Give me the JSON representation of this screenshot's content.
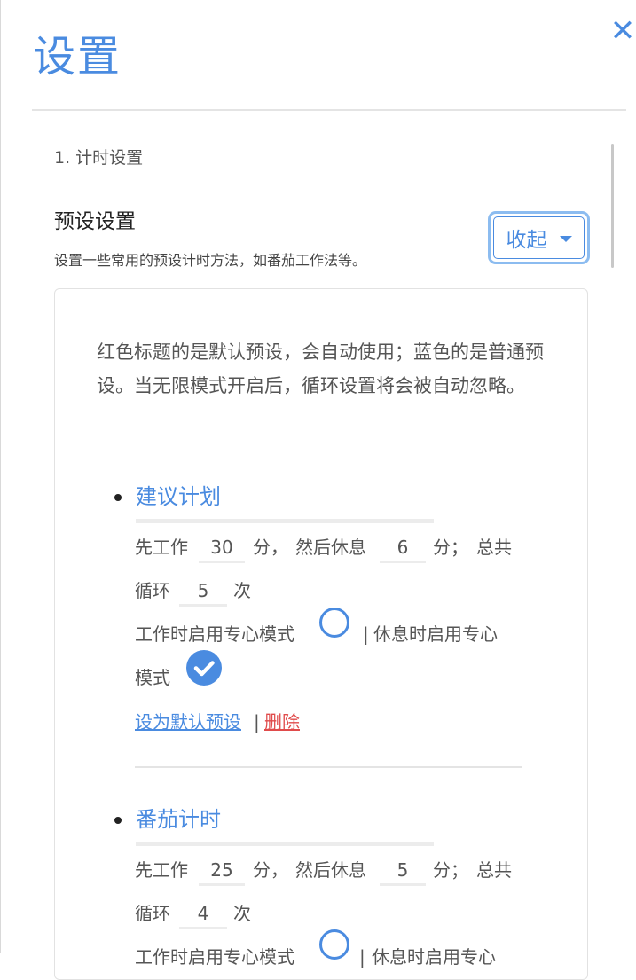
{
  "header": {
    "title": "设置",
    "close_label": "✕"
  },
  "section": {
    "label": "1. 计时设置"
  },
  "presets": {
    "title": "预设设置",
    "description": "设置一些常用的预设计时方法，如番茄工作法等。",
    "toggle_label": "收起",
    "intro": "红色标题的是默认预设，会自动使用；蓝色的是普通预设。当无限模式开启后，循环设置将会被自动忽略。",
    "items": [
      {
        "name": "建议计划",
        "work_prefix": "先工作",
        "work_minutes": "30",
        "after_work": "分，",
        "rest_prefix": "然后休息",
        "rest_minutes": "6",
        "after_rest": "分；",
        "total_prefix": "总共",
        "loop_prefix": "循环",
        "loops": "5",
        "loop_suffix": "次",
        "focus_work_label": "工作时启用专心模式",
        "focus_work_enabled": false,
        "separator": "|",
        "focus_rest_label_1": "休息时启用专心",
        "focus_rest_label_2": "模式",
        "focus_rest_enabled": true,
        "set_default_label": "设为默认预设",
        "delete_label": "删除"
      },
      {
        "name": "番茄计时",
        "work_prefix": "先工作",
        "work_minutes": "25",
        "after_work": "分，",
        "rest_prefix": "然后休息",
        "rest_minutes": "5",
        "after_rest": "分；",
        "total_prefix": "总共",
        "loop_prefix": "循环",
        "loops": "4",
        "loop_suffix": "次",
        "focus_work_label": "工作时启用专心模式",
        "focus_work_enabled": false,
        "separator": "|",
        "focus_rest_label_1": "休息时启用专心",
        "focus_rest_enabled": false
      }
    ]
  },
  "colors": {
    "accent": "#4a8be0",
    "danger": "#e04b4b"
  }
}
